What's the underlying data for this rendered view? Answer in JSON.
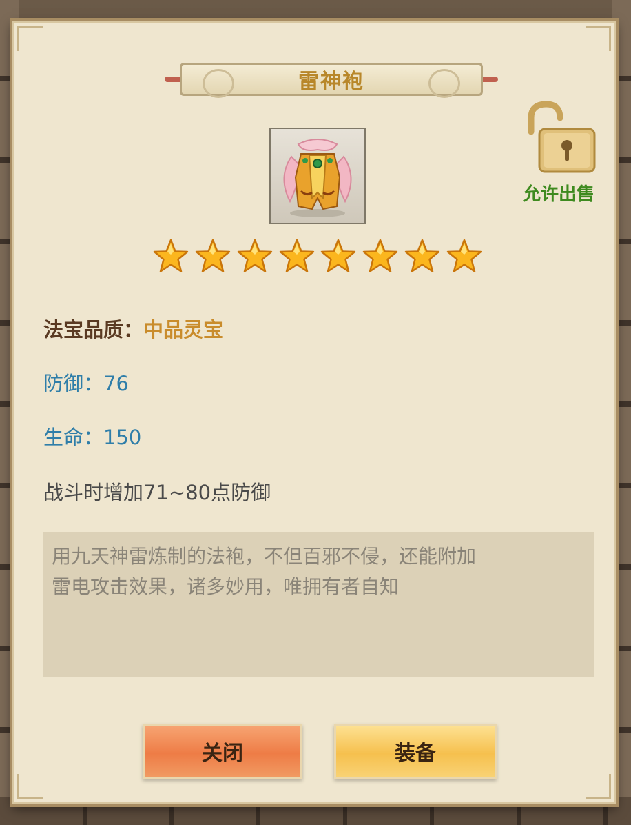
{
  "item": {
    "name": "雷神袍",
    "icon": "golden-robe-icon",
    "star_count": 8,
    "star_total": 8
  },
  "lock": {
    "icon": "padlock-open-icon",
    "label": "允许出售"
  },
  "attributes": {
    "quality_label": "法宝品质：",
    "quality_value": "中品灵宝",
    "defense_label": "防御：",
    "defense_value": "76",
    "life_label": "生命：",
    "life_value": "150",
    "effect": "战斗时增加71~80点防御"
  },
  "description": {
    "line1": "用九天神雷炼制的法袍，不但百邪不侵，还能附加",
    "line2": "雷电攻击效果，诸多妙用，唯拥有者自知"
  },
  "buttons": {
    "close_label": "关闭",
    "equip_label": "装备"
  },
  "colors": {
    "title": "#b8872a",
    "quality_value": "#c98c2c",
    "stat": "#2f7ea9",
    "lock_label": "#3e8a1f"
  }
}
